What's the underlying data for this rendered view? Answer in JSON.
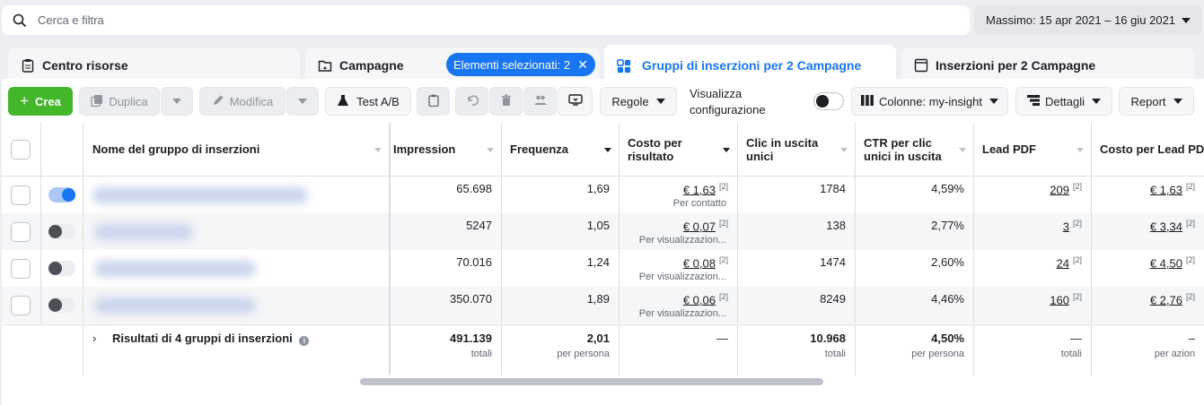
{
  "search": {
    "placeholder": "Cerca e filtra"
  },
  "date_range": "Massimo: 15 apr 2021 – 16 giu 2021",
  "tabs": [
    {
      "label": "Centro risorse"
    },
    {
      "label": "Campagne"
    },
    {
      "label": "Gruppi di inserzioni per 2 Campagne"
    },
    {
      "label": "Inserzioni per 2 Campagne"
    }
  ],
  "selected_pill": "Elementi selezionati: 2",
  "toolbar": {
    "create": "Crea",
    "duplicate": "Duplica",
    "edit": "Modifica",
    "ab_test": "Test A/B",
    "rules": "Regole",
    "view_config": "Visualizza configurazione",
    "columns": "Colonne: my-insight",
    "breakdown": "Dettagli",
    "report": "Report"
  },
  "columns": {
    "name": "Nome del gruppo di inserzioni",
    "impressions": "Impression",
    "frequency": "Frequenza",
    "cost_per_result": "Costo per risultato",
    "unique_outbound": "Clic in uscita unici",
    "ctr": "CTR per clic unici in uscita",
    "lead_pdf": "Lead PDF",
    "cost_per_lead": "Costo per Lead PDF"
  },
  "rows": [
    {
      "on": true,
      "impressions": "65.698",
      "frequency": "1,69",
      "cost": "€ 1,63",
      "cost_label": "Per contatto",
      "clicks": "1784",
      "ctr": "4,59%",
      "lead": "209",
      "cpl": "€ 1,63"
    },
    {
      "on": false,
      "impressions": "5247",
      "frequency": "1,05",
      "cost": "€ 0,07",
      "cost_label": "Per visualizzazion...",
      "clicks": "138",
      "ctr": "2,77%",
      "lead": "3",
      "cpl": "€ 3,34"
    },
    {
      "on": false,
      "impressions": "70.016",
      "frequency": "1,24",
      "cost": "€ 0,08",
      "cost_label": "Per visualizzazion...",
      "clicks": "1474",
      "ctr": "2,60%",
      "lead": "24",
      "cpl": "€ 4,50"
    },
    {
      "on": false,
      "impressions": "350.070",
      "frequency": "1,89",
      "cost": "€ 0,06",
      "cost_label": "Per visualizzazion...",
      "clicks": "8249",
      "ctr": "4,46%",
      "lead": "160",
      "cpl": "€ 2,76"
    }
  ],
  "footnote": "[2]",
  "totals": {
    "label": "Risultati di 4 gruppi di inserzioni",
    "impressions": "491.139",
    "impressions_sub": "totali",
    "frequency": "2,01",
    "frequency_sub": "per persona",
    "cost": "—",
    "clicks": "10.968",
    "clicks_sub": "totali",
    "ctr": "4,50%",
    "ctr_sub": "per persona",
    "lead": "—",
    "lead_sub": "totali",
    "cpl": "–",
    "cpl_sub": "per azion"
  },
  "colors": {
    "accent": "#1876f2",
    "create": "#42b72a"
  }
}
